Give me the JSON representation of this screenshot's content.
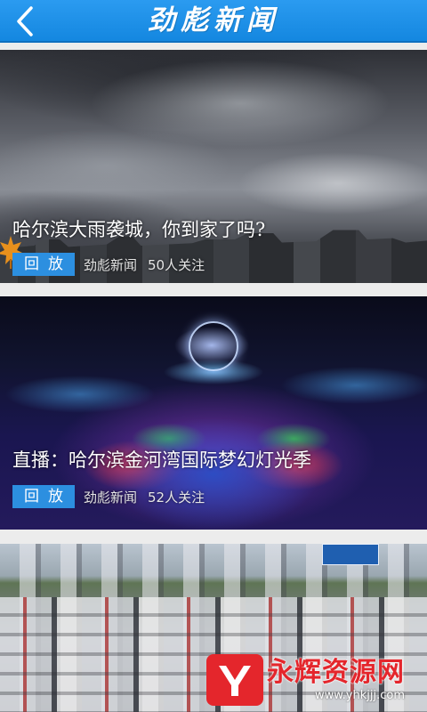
{
  "header": {
    "title": "劲彪新闻",
    "back_icon": "chevron-left-icon"
  },
  "feed": {
    "cards": [
      {
        "headline": "哈尔滨大雨袭城，你到家了吗?",
        "button_label": "回放",
        "source": "劲彪新闻",
        "followers": "50人关注"
      },
      {
        "headline": "直播：哈尔滨金河湾国际梦幻灯光季",
        "button_label": "回放",
        "source": "劲彪新闻",
        "followers": "52人关注"
      },
      {
        "headline": "",
        "button_label": "",
        "source": "",
        "followers": ""
      }
    ]
  },
  "watermark": {
    "name": "永辉资源网",
    "url": "www.yhkjjj.com"
  },
  "colors": {
    "header_blue": "#1a8ff0",
    "button_blue": "#2c8fe0",
    "watermark_red": "#e4262c"
  }
}
